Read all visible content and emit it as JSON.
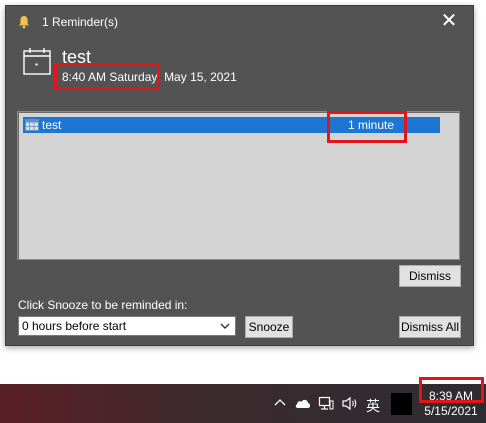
{
  "window": {
    "title": "1 Reminder(s)",
    "close_symbol": "✕"
  },
  "reminder": {
    "subject": "test",
    "time": "8:40 AM Saturday",
    "date": "May 15, 2021"
  },
  "list": {
    "rows": [
      {
        "subject": "test",
        "due_in": "1 minute"
      }
    ]
  },
  "buttons": {
    "dismiss": "Dismiss",
    "snooze": "Snooze",
    "dismiss_all": "Dismiss All"
  },
  "snooze": {
    "label": "Click Snooze to be reminded in:",
    "selected": "0 hours before start"
  },
  "taskbar": {
    "ime": "英",
    "clock_time": "8:39 AM",
    "clock_date": "5/15/2021"
  },
  "colors": {
    "window_bg": "#535353",
    "selection": "#1e76d3",
    "highlight": "#e3151b"
  }
}
